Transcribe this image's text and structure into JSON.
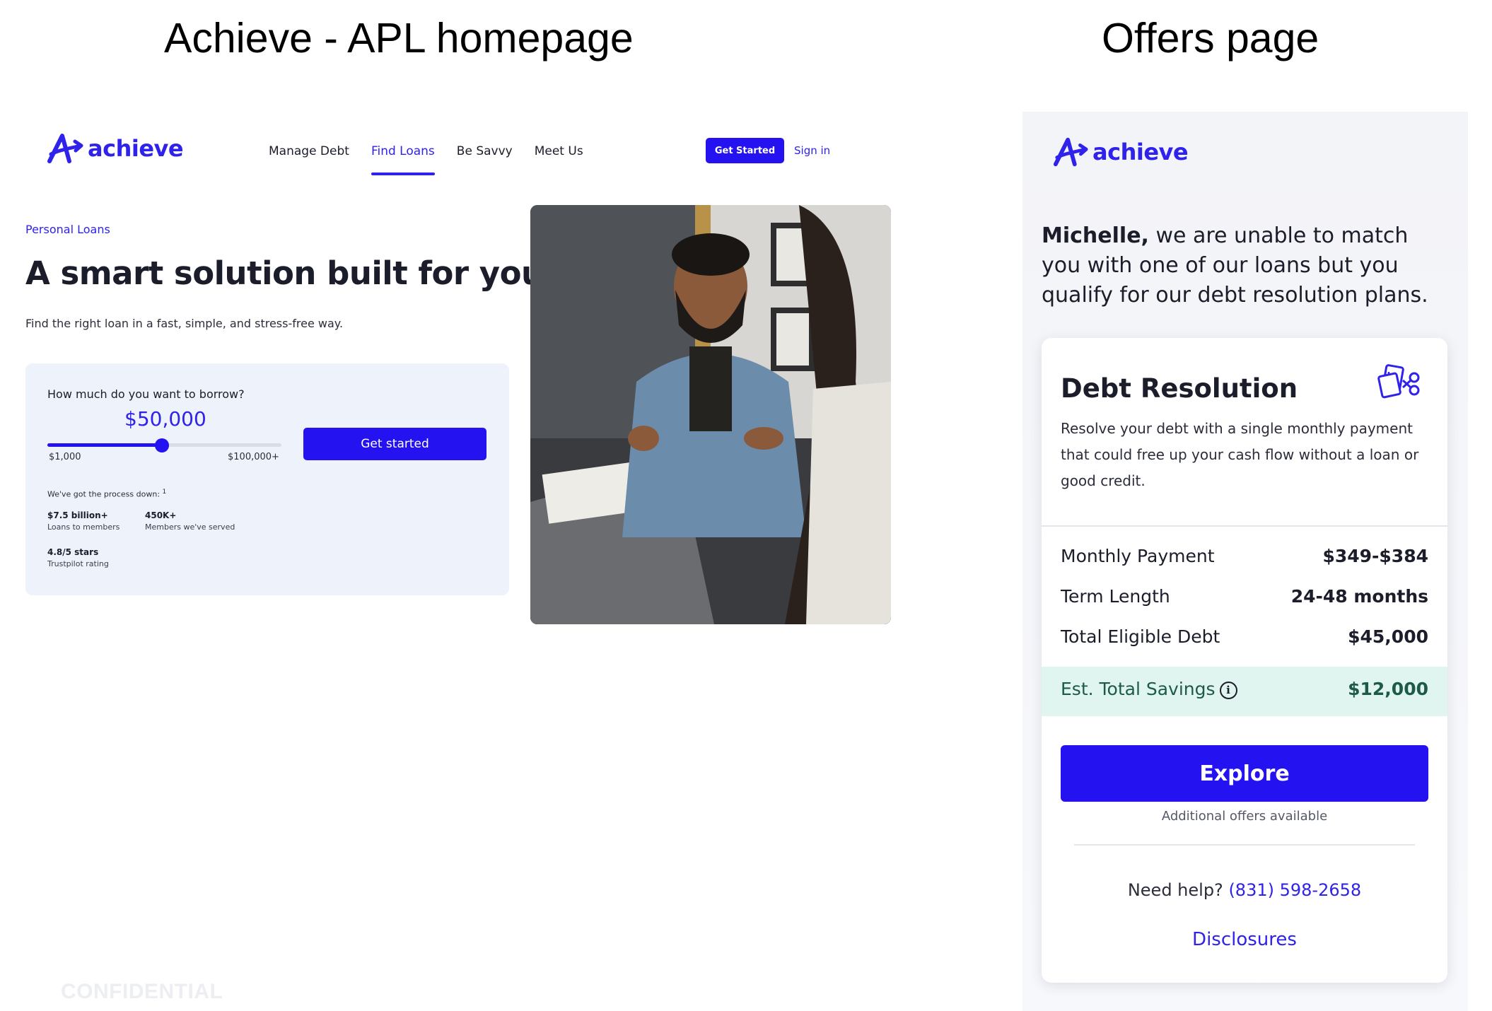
{
  "slide_titles": {
    "left": "Achieve - APL homepage",
    "right": "Offers page"
  },
  "homepage": {
    "logo_text": "achieve",
    "nav": [
      "Manage Debt",
      "Find Loans",
      "Be Savvy",
      "Meet Us"
    ],
    "active_nav": "Find Loans",
    "get_started_small": "Get Started",
    "sign_in": "Sign in",
    "eyebrow": "Personal Loans",
    "title": "A smart solution built for you",
    "subtitle": "Find the right loan in a fast, simple, and stress-free way.",
    "calculator": {
      "question": "How much do you want to borrow?",
      "amount": "$50,000",
      "slider_fraction": 0.49,
      "min_label": "$1,000",
      "max_label": "$100,000+",
      "cta": "Get started",
      "process_text": "We've got the process down:",
      "process_footnote": "1",
      "stats": [
        {
          "value": "$7.5 billion+",
          "label": "Loans to members"
        },
        {
          "value": "450K+",
          "label": "Members we've served"
        },
        {
          "value": "4.8/5 stars",
          "label": "Trustpilot rating"
        }
      ]
    },
    "photo_alt": "photo-smiling-man-with-advisor",
    "confidential": "CONFIDENTIAL"
  },
  "offers": {
    "logo_text": "achieve",
    "message_name": "Michelle,",
    "message_rest": " we are unable to match you with one of our loans but you qualify for our debt resolution plans.",
    "card": {
      "title": "Debt Resolution",
      "icon": "scissors-card-icon",
      "description": "Resolve your debt with a single monthly payment that could free up your cash flow without a loan or good credit.",
      "rows": [
        {
          "label": "Monthly Payment",
          "value": "$349-$384"
        },
        {
          "label": "Term Length",
          "value": "24-48 months"
        },
        {
          "label": "Total Eligible Debt",
          "value": "$45,000"
        }
      ],
      "savings_label": "Est. Total Savings",
      "savings_value": "$12,000",
      "cta": "Explore",
      "additional": "Additional offers available",
      "help_text": "Need help?",
      "phone": "(831) 598-2658",
      "disclosures": "Disclosures"
    }
  },
  "colors": {
    "brand_blue": "#2412f0",
    "savings_bg": "#e0f5f0"
  }
}
